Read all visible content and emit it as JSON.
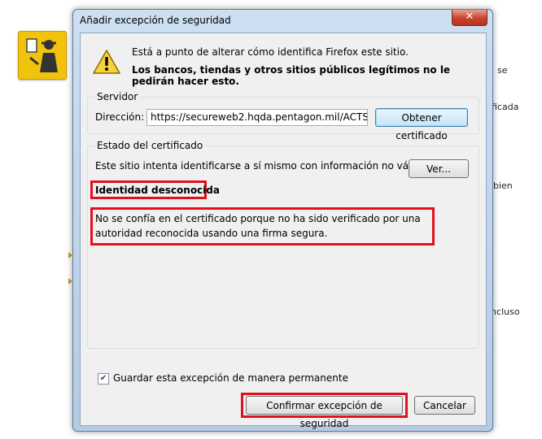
{
  "background": {
    "fragments": [
      "se",
      "ficada",
      "bien",
      "incluso"
    ]
  },
  "dialog": {
    "title": "Añadir excepción de seguridad",
    "close_symbol": "✕",
    "warning_line1": "Está a punto de alterar cómo identifica Firefox este sitio.",
    "warning_line2": "Los bancos, tiendas y otros sitios públicos legítimos no le pedirán hacer esto.",
    "server": {
      "group_label": "Servidor",
      "address_label": "Dirección:",
      "address_value": "https://secureweb2.hqda.pentagon.mil/ACTS_Onl",
      "get_cert_button": "Obtener certificado"
    },
    "cert_status": {
      "group_label": "Estado del certificado",
      "description": "Este sitio intenta identificarse a sí mismo con información no válida.",
      "view_button": "Ver...",
      "identity_heading": "Identidad desconocida",
      "explanation": "No se confía en el certificado porque no ha sido verificado por una autoridad reconocida usando una firma segura."
    },
    "save_permanently_label": "Guardar esta excepción de manera permanente",
    "save_permanently_checked": true,
    "confirm_button": "Confirmar excepción de seguridad",
    "cancel_button": "Cancelar"
  }
}
